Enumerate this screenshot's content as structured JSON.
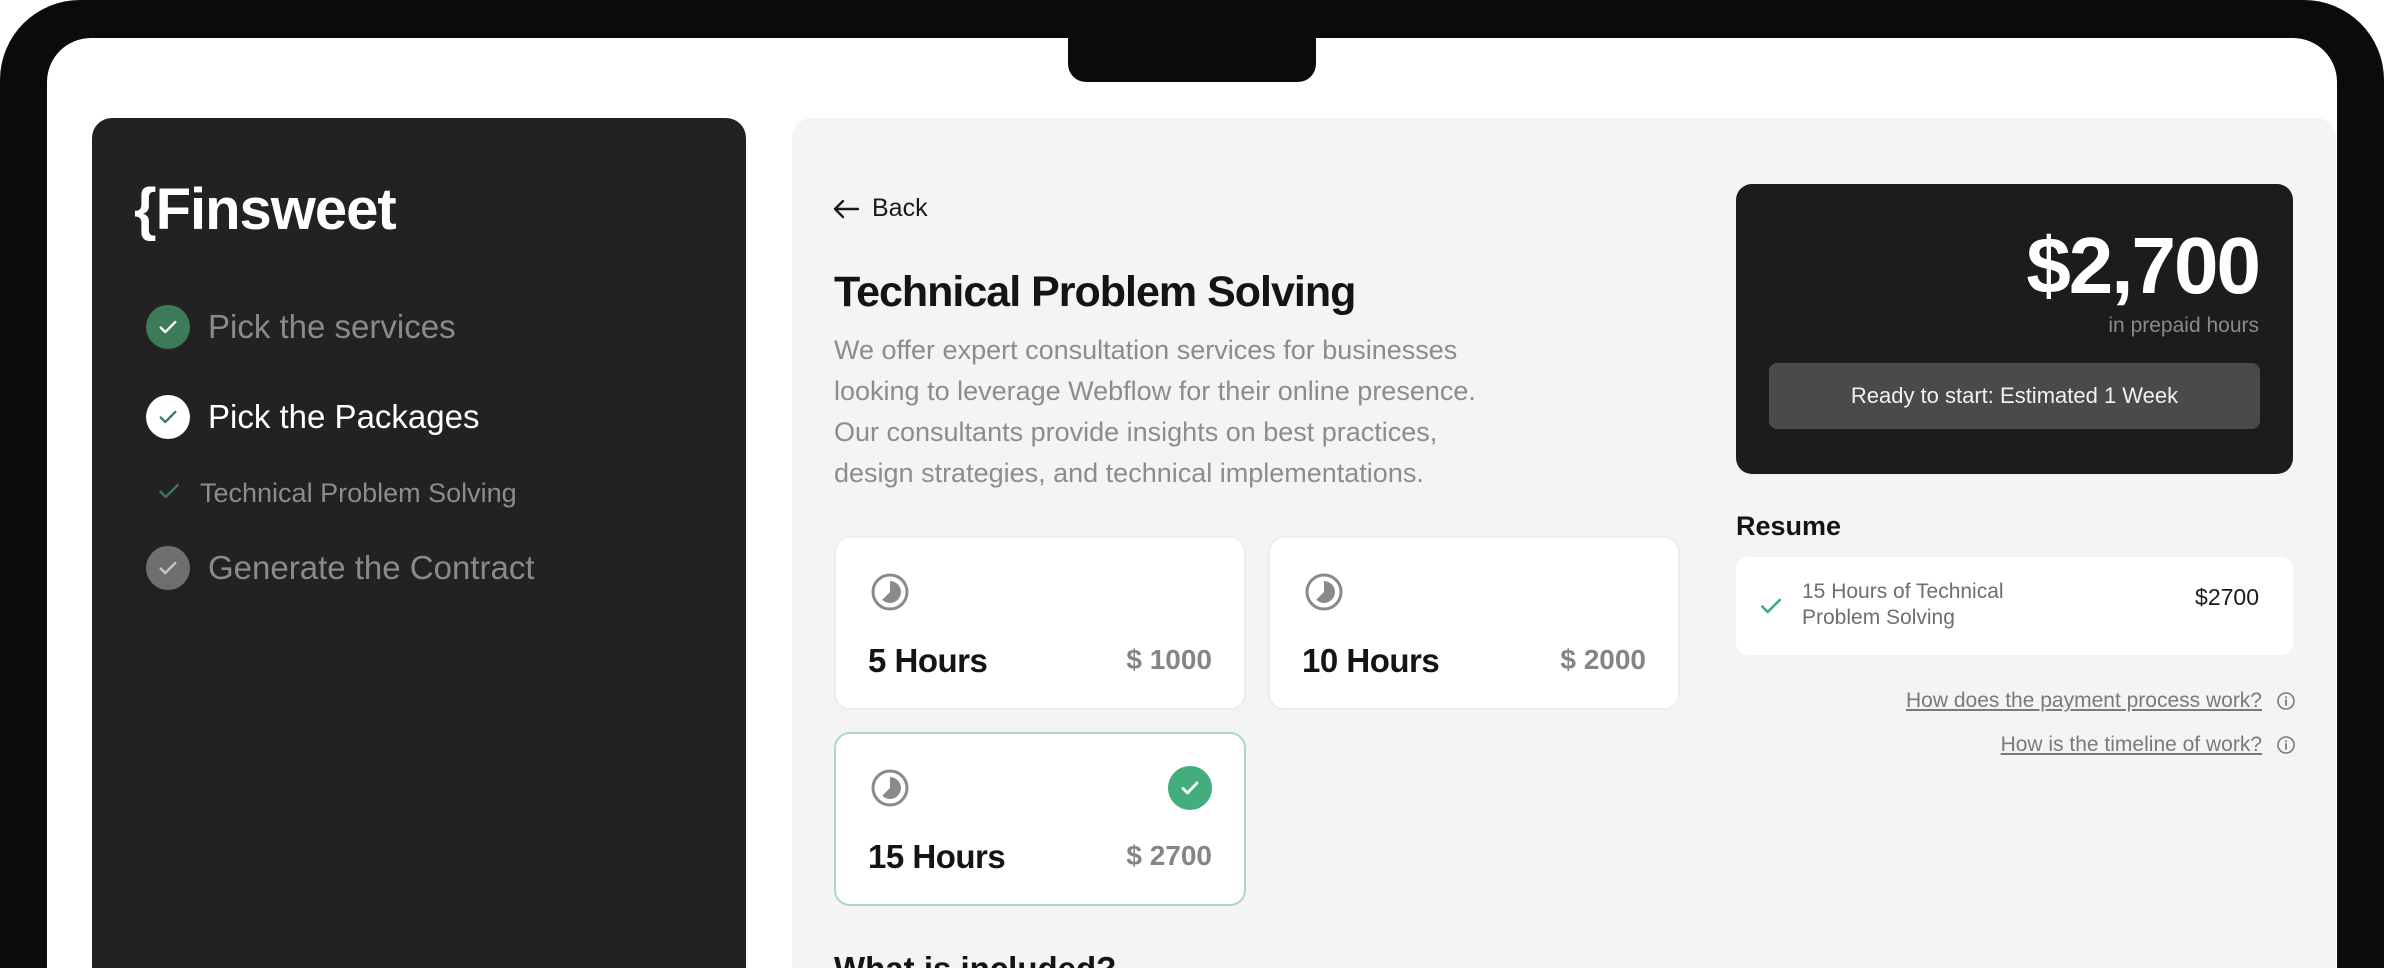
{
  "sidebar": {
    "logo": "{Finsweet",
    "steps": [
      {
        "label": "Pick the services",
        "state": "done"
      },
      {
        "label": "Pick the Packages",
        "state": "current"
      },
      {
        "label": "Technical Problem Solving",
        "state": "substep-done"
      },
      {
        "label": "Generate the Contract",
        "state": "pending"
      }
    ]
  },
  "main": {
    "back_label": "Back",
    "title": "Technical Problem Solving",
    "description": "We offer expert consultation services for businesses looking to leverage Webflow for their online presence. Our consultants provide insights on best practices, design strategies, and technical implementations.",
    "packages": [
      {
        "hours": "5 Hours",
        "price": "$ 1000",
        "selected": false
      },
      {
        "hours": "10 Hours",
        "price": "$ 2000",
        "selected": false
      },
      {
        "hours": "15 Hours",
        "price": "$ 2700",
        "selected": true
      }
    ],
    "included_heading": "What is included?"
  },
  "summary": {
    "total": "$2,700",
    "total_caption": "in prepaid hours",
    "ready_button": "Ready to start: Estimated 1 Week",
    "resume_title": "Resume",
    "resume_item": "15 Hours of Technical Problem Solving",
    "resume_amount": "$2700",
    "faq": [
      "How does the payment process work?",
      "How is the timeline of work?"
    ]
  },
  "colors": {
    "sidebar_bg": "#222222",
    "main_bg": "#f4f4f4",
    "accent_green": "#43ad7d",
    "price_card_bg": "#1c1c1c"
  },
  "icons": [
    "check-icon",
    "arrow-left-icon",
    "clock-icon",
    "info-icon"
  ]
}
